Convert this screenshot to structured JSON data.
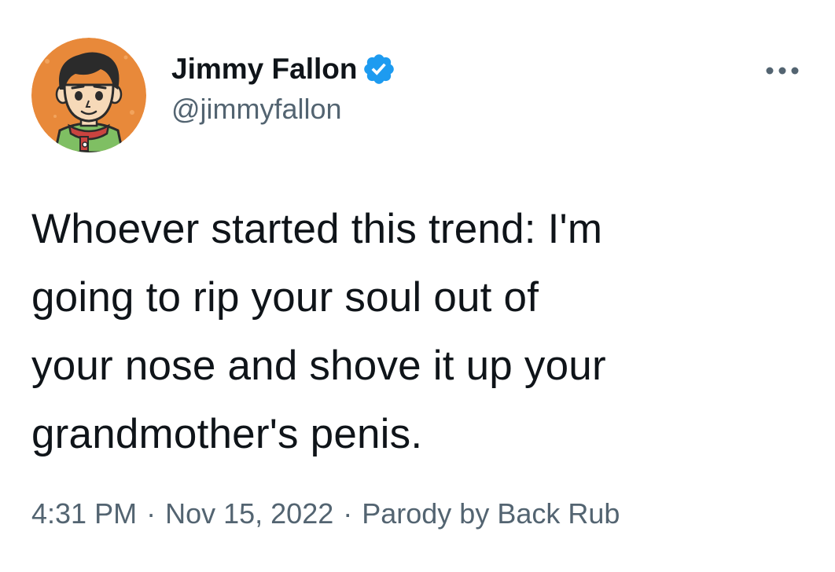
{
  "tweet": {
    "author": {
      "display_name": "Jimmy Fallon",
      "handle": "@jimmyfallon",
      "verified": true,
      "avatar_icon": "cartoon-portrait-avatar"
    },
    "more_icon": "ellipsis-icon",
    "text_lines": [
      "Whoever started this trend: I'm",
      "going to rip your soul out of",
      "your nose and shove it up your",
      "grandmother's penis."
    ],
    "time": "4:31 PM",
    "date": "Nov 15, 2022",
    "separator": "·",
    "source": "Parody by Back Rub"
  },
  "colors": {
    "text_primary": "#0f1419",
    "text_secondary": "#536471",
    "verified_blue": "#1d9bf0",
    "avatar_background": "#e8893a"
  }
}
